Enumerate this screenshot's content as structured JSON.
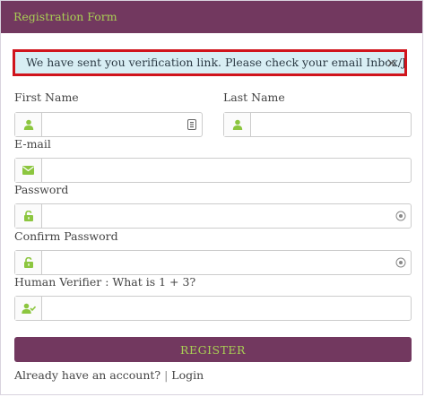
{
  "header": {
    "title": "Registration Form"
  },
  "alert": {
    "message": "We have sent you verification link. Please check your email Inbox/Junk Folder.",
    "close": "×"
  },
  "form": {
    "first_name_label": "First Name",
    "last_name_label": "Last Name",
    "email_label": "E-mail",
    "password_label": "Password",
    "confirm_password_label": "Confirm Password",
    "human_verifier_label": "Human Verifier : What is 1 + 3?",
    "register_label": "REGISTER"
  },
  "footer": {
    "have_account": "Already have an account?",
    "separator": "|",
    "login_link": "Login"
  },
  "icons": {
    "first_name": "user-icon",
    "last_name": "user-icon",
    "email": "envelope-icon",
    "password": "unlock-icon",
    "confirm_password": "unlock-icon",
    "human_verifier": "user-check-icon",
    "reveal": "eye-icon",
    "autofill": "contact-card-icon"
  },
  "colors": {
    "header_bg": "#72385f",
    "accent_green": "#a9cf54",
    "alert_bg": "#d8eef4",
    "alert_border": "#d0141c"
  }
}
